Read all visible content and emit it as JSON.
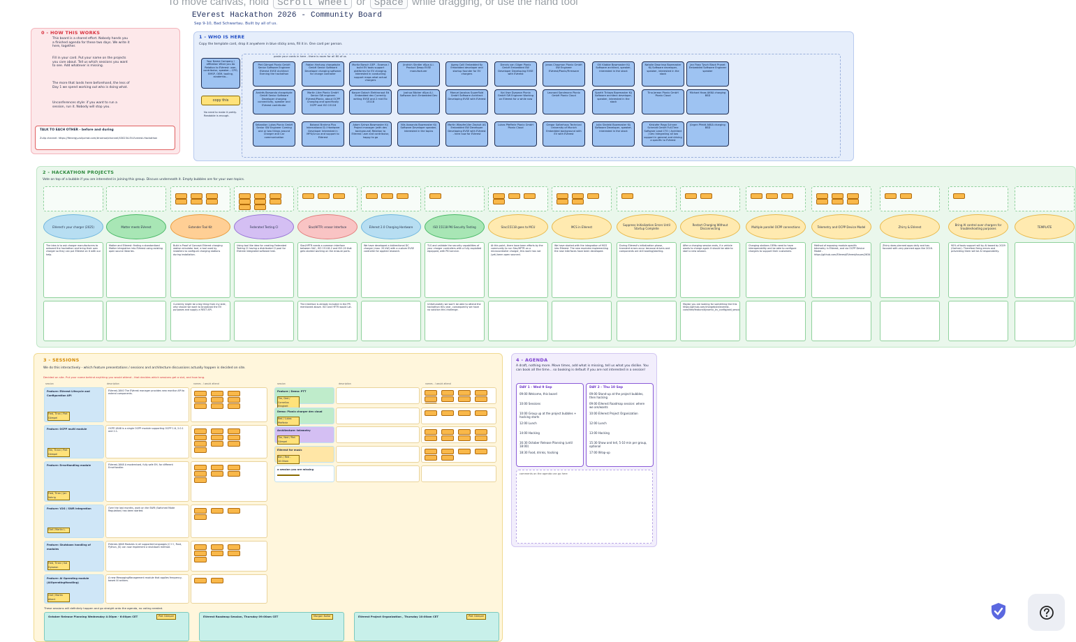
{
  "hint": {
    "pre": "To move canvas, hold",
    "key1": "Scroll wheel",
    "mid": "or",
    "key2": "Space",
    "post": "while dragging, or use the hand tool"
  },
  "board": {
    "title": "EVerest Hackathon 2026 - Community Board",
    "subtitle": "Sep 9-10, Bad Schwartau. Built by all of us."
  },
  "section0": {
    "title": "0 - HOW THIS WORKS",
    "para1": "This board is a shared effort. Nobody hands you a finished agenda for these two days. We write it here, together.",
    "para2": "Fill in your card. Put your name on the projects you care about. Tell us which sessions you want to see. Add whatever is missing.",
    "para3": "The more that lands here beforehand, the less of Day 1 we spend working out who is doing what.",
    "para4": "Unconferences style: if you want to run a session, run it. Nobody will stop you.",
    "talk_title": "TALK TO EACH OTHER - before and during",
    "talk_text": "Zulip channel: https://lfenergy.zulipchat.com/#narrow/channel/430234-EV-Everest-Hackathon"
  },
  "section1": {
    "title": "1 - WHO IS HERE",
    "intro": "Copy the template card, drop it anywhere in blue sticky area, fill it in. One card per person.",
    "paste_hint": "paste your cards in here - there is room for all 80 of us",
    "template_card": "Your Name Company / affiliation What you do Relation to EVerest: user, contributor, speaker... CPO, EMSP, OEM, tooling, academia...",
    "copy_label": "copy this",
    "keep_short": "No need to make it pretty. Readable is enough.",
    "cards": [
      "Piet Gömpel Pionix GmbH Senior Software Engineer EVerest EVSE Architect Evening the hackathon",
      "Andrés Barsando chargebyte GmbH Senior Software Developer charging connectivity, speaker and EVerest contributor",
      "Sebastian Lukas Pionix GmbH Senior SW Engineer Coming one or two things around Charger and Car communication",
      "Fabian Hartung chargebyte GmbH Senior Software Developer charging software for charge controller",
      "Martin Litre Pionix GmbH Senior SW engineer EVerest/Pionix, about OCPP Charging and specifically OCPP and ISO 15118",
      "Botanal Brahma Plus International D-l Hardware Developer Interested in MPU/Linux and support to EVerest",
      "Moritz Barsch GEP - Ecamos I build EV tools support platforms for EV charging. Interested in conducting support maps what actual chargers",
      "Kacper Dalach Elektronaut Ed Embedded dev Currently writing EVSE and 2 mid Etc 15118",
      "Adam Szirwa Bowmaster Kij Project manager (with dev background) Relation to EVerest: user and contributor, happy to go",
      "Jindrich Skrdler dSpa A.I. Product Dewp EVSE manufacturer",
      "Joshua Bäcker dSpa A.I. Software Arch Embedded Dev",
      "Nils Aswanda Bowmaster Kij Software Developer speaker, interested in the topics",
      "Agerg Calil Embedded Ky Embedded developer and startup founder for EV chargers",
      "Manuel Jacobus Superfluid GmbH Software Architect Developing EVSE with EVerest",
      "Martin Wiepfmüller Zeptuit AG Embedded SW Developer Developing EVSE with EVerest - here now for EVerest",
      "Dennis van Gilger Pionix GmbH Embedded SW Developer Developing EVSE with EVerest",
      "Kai Uwe Dysseon Pionix GmbH SW Engineer Working on EVerest for a while now",
      "Lukas Pfefferle Pionix GmbH Pionix Cloud",
      "Janos Chapman Pionix GmbH SW Engineer EVerest/Pionix/Firmware",
      "Leonard Sandmann Pionix GmbH Pionix Cloud",
      "Gregor Salterhaus Technical University of Munich Embedded background with EV with EVerest",
      "Olli Klabbe Bowmaster Kij Software architect, speaker, interested in the stack",
      "Sparth Tirkaza Bowmaster Kij Software architect developer, speaker, interested in the stack",
      "Julia Sindebi Bowmaster Kij Software Developer, speaker, interested in the stack",
      "Natalie Dworinsa Bowmaster Kij Software developer, speaker, interested in the stack",
      "Tina Jerean Pionix GmbH Pionix Cloud",
      "Kristofer Rego Schnee Schmidt GmbH Full-Time Software Lead CTO / Architect / Dev Integrating all low support in general and driving a specific to EVerest",
      "Jan Fisey Tysch Black Pronet Embedded Software Engineer speaker",
      "Michael Haas AKKA charging BSD",
      "Jürgen Pfeidt AKKA charging BSD",
      "David Nguyen Crossfire / Vlookout speaker",
      "Christoph Kroth van Ruthy Innolk Crossfire / Sat Dev speaker",
      "Andrés Saltona Crossfire / Sat Dev, Sat Arch speaker"
    ]
  },
  "section2": {
    "title": "2 - HACKATHON PROJECTS",
    "intro": "Vote on top of a bubble if you are interested in joining this group. Discuss underneath it. Empty bubbles are for your own topics.",
    "interested_label": "interested",
    "description_label": "description",
    "issues_label": "issues",
    "projects": [
      {
        "name": "EVerest's your charger (2025)",
        "color": "#b7def2",
        "border": "#6fb6dd",
        "desc": "The idea is to ask charger manufacturers to onboard the hackathon and bring their own charger so they can put EVerest on it with our help.",
        "issue": ""
      },
      {
        "name": "Matter meets EVerest",
        "color": "#a8e6b5",
        "border": "#49b866",
        "desc": "Matter and EVerest: finding a standardized Matter integration into EVerest using existing open source libraries.",
        "issue": ""
      },
      {
        "name": "Extender Tool Kit",
        "color": "#ffcf95",
        "border": "#e99a3b",
        "desc": "Build a Proof of Concept EVerest charging station simulator tool, a tool used by installers to configure charging stations during installation.",
        "issue": "Currently might be a big thing from my side, why should we want to broadcast the EV purposes and supply a REST API."
      },
      {
        "name": "Federated Testing CI",
        "color": "#d4bff3",
        "border": "#9774d6",
        "desc": "Using tool like idea for creating Federated Testing CI having a distributed CI pool for EVerest integrated software test.",
        "issue": ""
      },
      {
        "name": "Slac/HFTR: erasor Interface",
        "color": "#f9c4c4",
        "border": "#e27b7b",
        "desc": "Slac/HPTR needs a common interface between SAC, ISO 15118-2 and ISO-20 that gets started working on the erasure parts.",
        "issue": "The interface is already included in the PR mentioned above. ISO and HFTR would Lat."
      },
      {
        "name": "EVerest 2.0 Charging Hardware",
        "color": "#b7def2",
        "border": "#6fb6dd",
        "desc": "We have developed a bidirectional DC charger (max. 20 kW) with a custom EVSE controller for applied research.",
        "issue": ""
      },
      {
        "name": "ISO 15118 PKI Security Testing",
        "color": "#a8e6b5",
        "border": "#49b866",
        "desc": "TLS and validate the security capabilities of your charger controllers with a fully exploited equipped, with PKI service.",
        "issue": "Unfortunately we won't be able to attend the hackathon this year, consequently we have no solution this challenge."
      },
      {
        "name": "Slac/15118 goes to MCU",
        "color": "#ffeab0",
        "border": "#e7b84a",
        "desc": "At this point, there have been efforts by the community to run Slac/HPTR on a microcontroller charger, this work has not (yet) been open sourced.",
        "issue": ""
      },
      {
        "name": "MCS in EVerest",
        "color": "#ffeab0",
        "border": "#e7b84a",
        "desc": "We have started with the integration of MCS into EVerest. The new modules implementing the new interfaces have been developed.",
        "issue": ""
      },
      {
        "name": "Suppress Initialization Errors Until Startup Complete",
        "color": "#ffeab0",
        "border": "#e7b84a",
        "desc": "During EVerest's initialization phase, transient errors occur because drivers and components are still loading/starting.",
        "issue": ""
      },
      {
        "name": "Restart Charging Without Disconnecting",
        "color": "#ffeab0",
        "border": "#e7b84a",
        "desc": "After a charging session ends, if a vehicle wants to charge again it should be able to start a new session.",
        "issue": "Maybe you are looking for something like this https://github.com/chargebyte/everest-core/tree/feature/dynamic_ev_config/add_session_reinitiation/"
      },
      {
        "name": "Multiple parallel OCPP connections",
        "color": "#ffeab0",
        "border": "#e7b84a",
        "desc": "Charging stations OEMs need to have interoperability and be able to configure chargers to support their customers.",
        "issue": ""
      },
      {
        "name": "Telemetry and OCPP Device Model",
        "color": "#ffeab0",
        "border": "#e7b84a",
        "desc": "Method of exposing module-specific telemetry in EVerest, and via OCPP Device Model - https://github.com/EVerest/EVerest/issues/2634",
        "issue": ""
      },
      {
        "name": "Zhirry & EVerest",
        "color": "#ffeab0",
        "border": "#e7b84a",
        "desc": "Zhirry does planned apps daily and has focused with very planned apps like 2016.",
        "issue": ""
      },
      {
        "name": "Bring AI control over chargers for troubleshooting purposes",
        "color": "#ffeab0",
        "border": "#e7b84a",
        "desc": "90% of tools support will by AI based by 2029 (Gartner). Therefore fixing errors and preventing them will be AI responsibility.",
        "issue": ""
      },
      {
        "name": "TEMPLATE",
        "color": "#ffeab0",
        "border": "#e7b84a",
        "desc": "",
        "issue": ""
      }
    ]
  },
  "section3": {
    "title": "3 - SESSIONS",
    "intro": "We do this interactively - which feature presentations / sessions and architecture discussions actually happen is decided on site.",
    "hint": "Decided on site. Put your name behind anything you would attend - that decides which sessions get a slot, and how long.",
    "col_session": "session",
    "col_description": "description",
    "col_names": "names - I would attend",
    "left_sessions": [
      {
        "title": "Feature: EVerest Lifecycle and Configuration API",
        "host": "Fred, Tiran / Piet Gömpel",
        "desc": "EVerest-1840 The EVerest manager provides new monitor API to extend components."
      },
      {
        "title": "Feature: OCPP multi module",
        "host": "Tim, Tirani / Piet Gömpel",
        "desc": "OCPP-1848 is a single OCPP module supporting OCPP 1.6, 2.0.1 and 2.1."
      },
      {
        "title": "Feature: ErrorHandling module",
        "host": "Fred, Tiran / Jan Vahrig",
        "desc": "EVerest-1848 A modernised, fully safe EH, for different ErrorHandler."
      },
      {
        "title": "Feature: V2G / SWR integration",
        "host": "Olaf / Martin L.",
        "desc": "Over the last months, work on the SWR (Switched Mode Regulation) has been started."
      },
      {
        "title": "Feature: Shutdown handling of modules",
        "host": "Fred, Tirani / Kai Dysseon",
        "desc": "EVerest-1848 Modules in all supported languages (C++, Rust, Python, JS) can now implement a shutdown method."
      },
      {
        "title": "Feature: AI Operating module (AIOperatingHandling)",
        "host": "Olaf / Martin Albert",
        "desc": "A new MessagingManagement module that applies frequency-based AI actions."
      }
    ],
    "right_sessions": [
      {
        "title": "Feature / Demo: PTT",
        "host": "Tim, Ded / Cornelius Elingkeit",
        "color": "#bfeccb"
      },
      {
        "title": "Demo: Pionix charger dev cloud",
        "host": "Red / Lukas Pfefferle",
        "color": "#bfeccb"
      },
      {
        "title": "Architecture: telemetry",
        "host": "Tim, Ned / Piet Gömpel",
        "color": "#d4bff3"
      },
      {
        "title": "EVerest for music",
        "host": "Ben / Red - 10:00am",
        "color": "#ffe6a6"
      },
      {
        "title": "a session you are missing",
        "host": "",
        "color": "#fff"
      }
    ],
    "footer_note": "These sessions will definitely happen and go straight onto the agenda, no voting needed.",
    "footer_sessions": [
      {
        "title": "October Release Planning Wednesday 4:30pm - 6:00pm CET",
        "host": "Piet Gömpel"
      },
      {
        "title": "EVerest Roadmap Session, Thursday 09:00am CET",
        "host": "Morgan Kollar"
      },
      {
        "title": "EVerest Project Organization , Thursday 10:00am CET",
        "host": "Piet Gömpel"
      }
    ]
  },
  "section4": {
    "title": "4 - AGENDA",
    "intro": "A draft, nothing more. Move times, add what is missing, tell us what you dislike. You can book all the time... so booking is default if you are not interested in a session!",
    "day1_title": "DAY 1 - Wed 9 Sep",
    "day1": [
      "09:00 Welcome, this board",
      "10:00 Sessions",
      "10:00 Group up at the project bubbles + hacking starts",
      "12:00 Lunch",
      "14:00 Hacking",
      "16:30 October Release Planning (until 18:00)",
      "18:30 Food, drinks, hacking"
    ],
    "day2_title": "DAY 2 - Thu 10 Sep",
    "day2": [
      "09:00 Stand-up at the project bubbles, then hacking",
      "09:00 EVerest Roadmap session: where we are/wants",
      "10:00 EVerest Project Organization",
      "12:00 Lunch",
      "13:00 Hacking",
      "15:30 Show and tell, 5-10 min per group, optional",
      "17:00 Wrap-up"
    ],
    "comments": "comments on the agenda can go here"
  },
  "controls": {
    "shield_icon": "shield-check-icon",
    "help_icon": "question-icon",
    "accent": "#5b68e0"
  }
}
